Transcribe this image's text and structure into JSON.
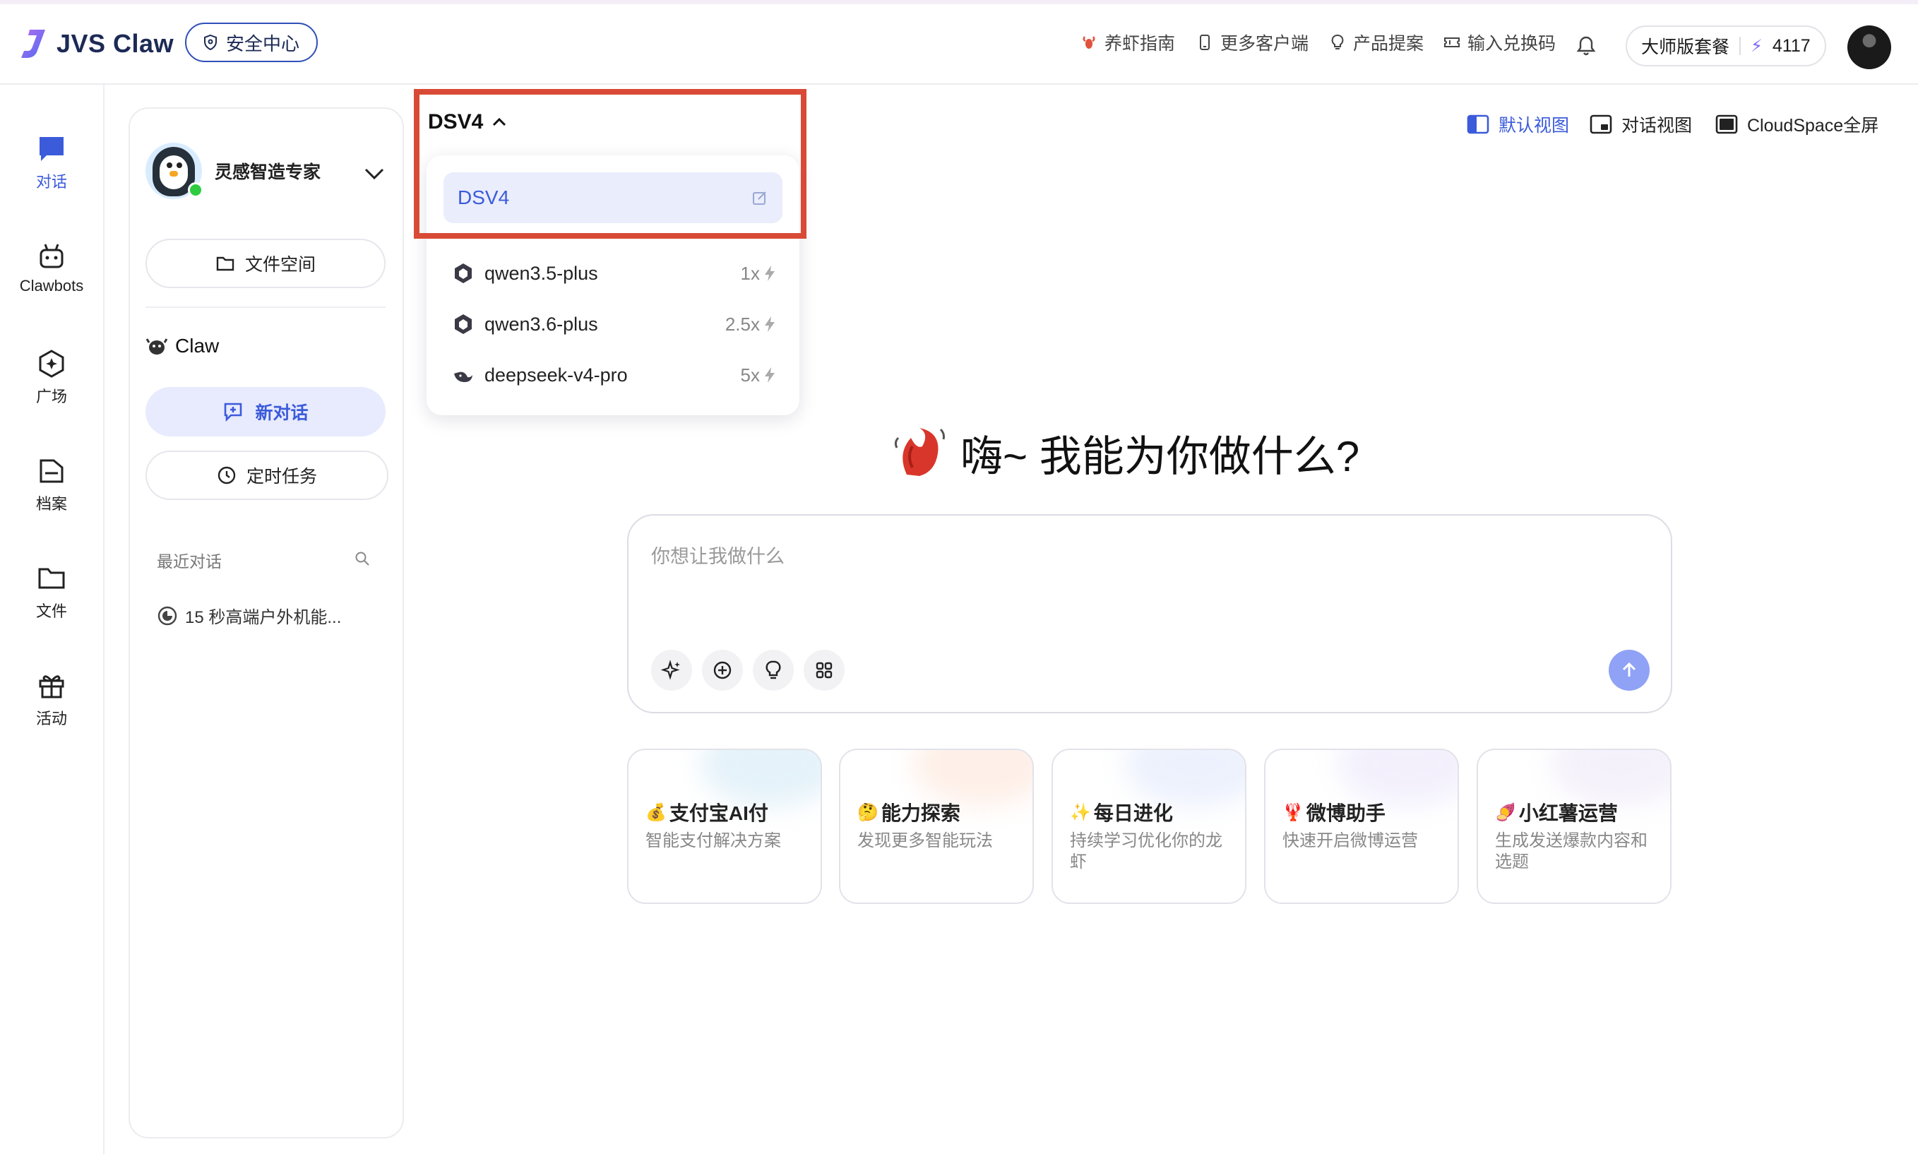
{
  "app": {
    "name": "JVS Claw",
    "security_center": "安全中心"
  },
  "header_nav": [
    {
      "label": "养虾指南",
      "icon": "lobster-icon"
    },
    {
      "label": "更多客户端",
      "icon": "phone-icon"
    },
    {
      "label": "产品提案",
      "icon": "lightbulb-icon"
    },
    {
      "label": "输入兑换码",
      "icon": "ticket-icon"
    }
  ],
  "plan": {
    "name": "大师版套餐",
    "credits": "4117"
  },
  "rail": [
    {
      "label": "对话"
    },
    {
      "label": "Clawbots"
    },
    {
      "label": "广场"
    },
    {
      "label": "档案"
    },
    {
      "label": "文件"
    },
    {
      "label": "活动"
    }
  ],
  "sidebar": {
    "agent_name": "灵感智造专家",
    "file_space": "文件空间",
    "section_title": "Claw",
    "new_chat": "新对话",
    "scheduled_tasks": "定时任务",
    "recent_title": "最近对话",
    "recent_items": [
      "15 秒高端户外机能..."
    ]
  },
  "model_selector": {
    "current": "DSV4",
    "options": [
      {
        "name": "DSV4",
        "multiplier": ""
      },
      {
        "name": "qwen3.5-plus",
        "multiplier": "1x"
      },
      {
        "name": "qwen3.6-plus",
        "multiplier": "2.5x"
      },
      {
        "name": "deepseek-v4-pro",
        "multiplier": "5x"
      }
    ]
  },
  "views": {
    "default": "默认视图",
    "chat": "对话视图",
    "cloudspace": "CloudSpace全屏"
  },
  "hero": {
    "greeting": "嗨~ 我能为你做什么?"
  },
  "composer": {
    "placeholder": "你想让我做什么"
  },
  "cards": [
    {
      "emoji": "💰",
      "title": "支付宝AI付",
      "desc": "智能支付解决方案",
      "glow": "#cfe8f5"
    },
    {
      "emoji": "🤔",
      "title": "能力探索",
      "desc": "发现更多智能玩法",
      "glow": "#fde3d6"
    },
    {
      "emoji": "✨",
      "title": "每日进化",
      "desc": "持续学习优化你的龙虾",
      "glow": "#dde6fb"
    },
    {
      "emoji": "🦞",
      "title": "微博助手",
      "desc": "快速开启微博运营",
      "glow": "#e9e4fa"
    },
    {
      "emoji": "🍠",
      "title": "小红薯运营",
      "desc": "生成发送爆款内容和选题",
      "glow": "#ece6f7"
    }
  ],
  "colors": {
    "accent": "#3b5bdb",
    "highlight_border": "#d94a36",
    "brand_dark": "#1c2a55"
  }
}
